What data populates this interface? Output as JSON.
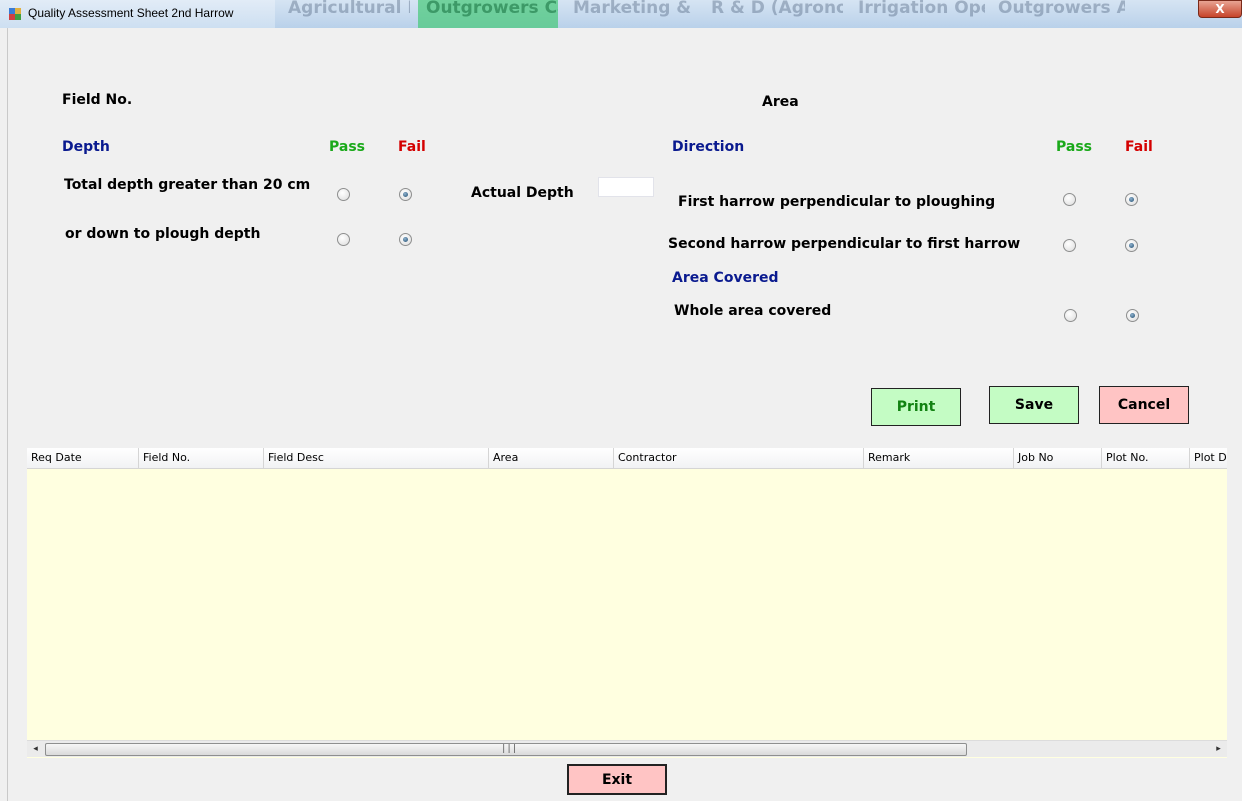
{
  "window": {
    "title": "Quality Assessment Sheet 2nd Harrow",
    "close_glyph": "X",
    "background_tabs": [
      "Agricultural Engineering",
      "Outgrowers Cane Dev",
      "Marketing & Transport",
      "R & D (Agronomy)",
      "Irrigation Operation",
      "Outgrowers Accounts"
    ]
  },
  "form": {
    "field_no_label": "Field No.",
    "area_label": "Area",
    "depth": {
      "heading": "Depth",
      "pass_label": "Pass",
      "fail_label": "Fail",
      "rows": [
        {
          "label": "Total depth greater than 20 cm",
          "selected": "fail"
        },
        {
          "label": "or down to plough depth",
          "selected": "fail"
        }
      ],
      "actual_depth_label": "Actual Depth",
      "actual_depth_value": ""
    },
    "direction": {
      "heading": "Direction",
      "pass_label": "Pass",
      "fail_label": "Fail",
      "rows": [
        {
          "label": "First harrow perpendicular to ploughing",
          "selected": "fail"
        },
        {
          "label": "Second harrow perpendicular to first harrow",
          "selected": "fail"
        }
      ]
    },
    "area_covered": {
      "heading": "Area Covered",
      "rows": [
        {
          "label": "Whole area covered",
          "selected": "fail"
        }
      ]
    }
  },
  "buttons": {
    "print": "Print",
    "save": "Save",
    "cancel": "Cancel",
    "exit": "Exit"
  },
  "grid": {
    "columns": [
      "Req Date",
      "Field No.",
      "Field Desc",
      "Area",
      "Contractor",
      "Remark",
      "Job No",
      "Plot No.",
      "Plot D"
    ],
    "rows": [],
    "scroll_left_glyph": "◂",
    "scroll_right_glyph": "▸",
    "scroll_grip": "|||"
  },
  "colors": {
    "heading_navy": "#0a1a8f",
    "pass_green": "#1aa91a",
    "fail_red": "#d40000",
    "grid_background": "#ffffe0",
    "pass_button": "#c4fcc4",
    "cancel_button": "#ffc4c4"
  }
}
